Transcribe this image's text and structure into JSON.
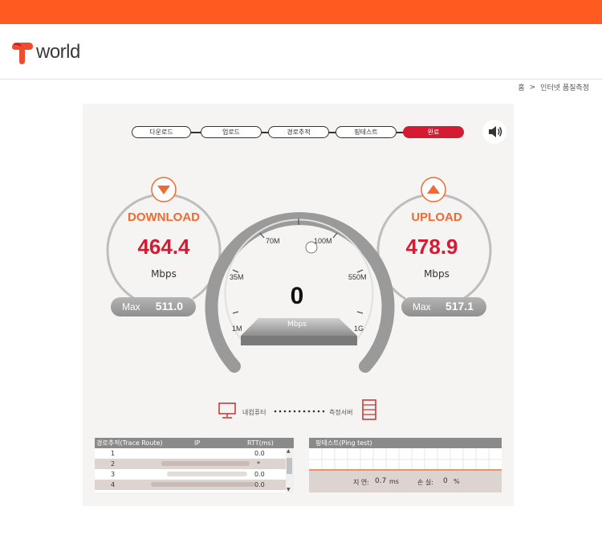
{
  "brand": {
    "logo_text": "world"
  },
  "breadcrumb": {
    "home": "홈",
    "current": "인터넷 품질측정"
  },
  "steps": [
    "다운로드",
    "업로드",
    "경로추적",
    "핑테스트",
    "완료"
  ],
  "download": {
    "label": "DOWNLOAD",
    "value": "464.4",
    "unit": "Mbps",
    "max_label": "Max",
    "max_value": "511.0"
  },
  "upload": {
    "label": "UPLOAD",
    "value": "478.9",
    "unit": "Mbps",
    "max_label": "Max",
    "max_value": "517.1"
  },
  "gauge": {
    "value": "0",
    "unit": "Mbps",
    "ticks": [
      "1M",
      "35M",
      "70M",
      "100M",
      "550M",
      "1G"
    ]
  },
  "network": {
    "my_pc": "내컴퓨터",
    "server": "측정서버"
  },
  "trace": {
    "title": "경로추적(Trace Route)",
    "col_ip": "IP",
    "col_rtt": "RTT(ms)",
    "rows": [
      {
        "hop": "1",
        "rtt": "0.0"
      },
      {
        "hop": "2",
        "rtt": "*"
      },
      {
        "hop": "3",
        "rtt": "0.0"
      },
      {
        "hop": "4",
        "rtt": "0.0"
      }
    ]
  },
  "ping": {
    "title": "핑테스트(Ping test)",
    "latency_label": "지 연:",
    "latency_value": "0.7",
    "latency_unit": "ms",
    "loss_label": "손 실:",
    "loss_value": "0",
    "loss_unit": "%"
  },
  "colors": {
    "topbar": "#ff5a1f",
    "accent_red": "#d41b32",
    "accent_orange": "#ef6a32"
  }
}
